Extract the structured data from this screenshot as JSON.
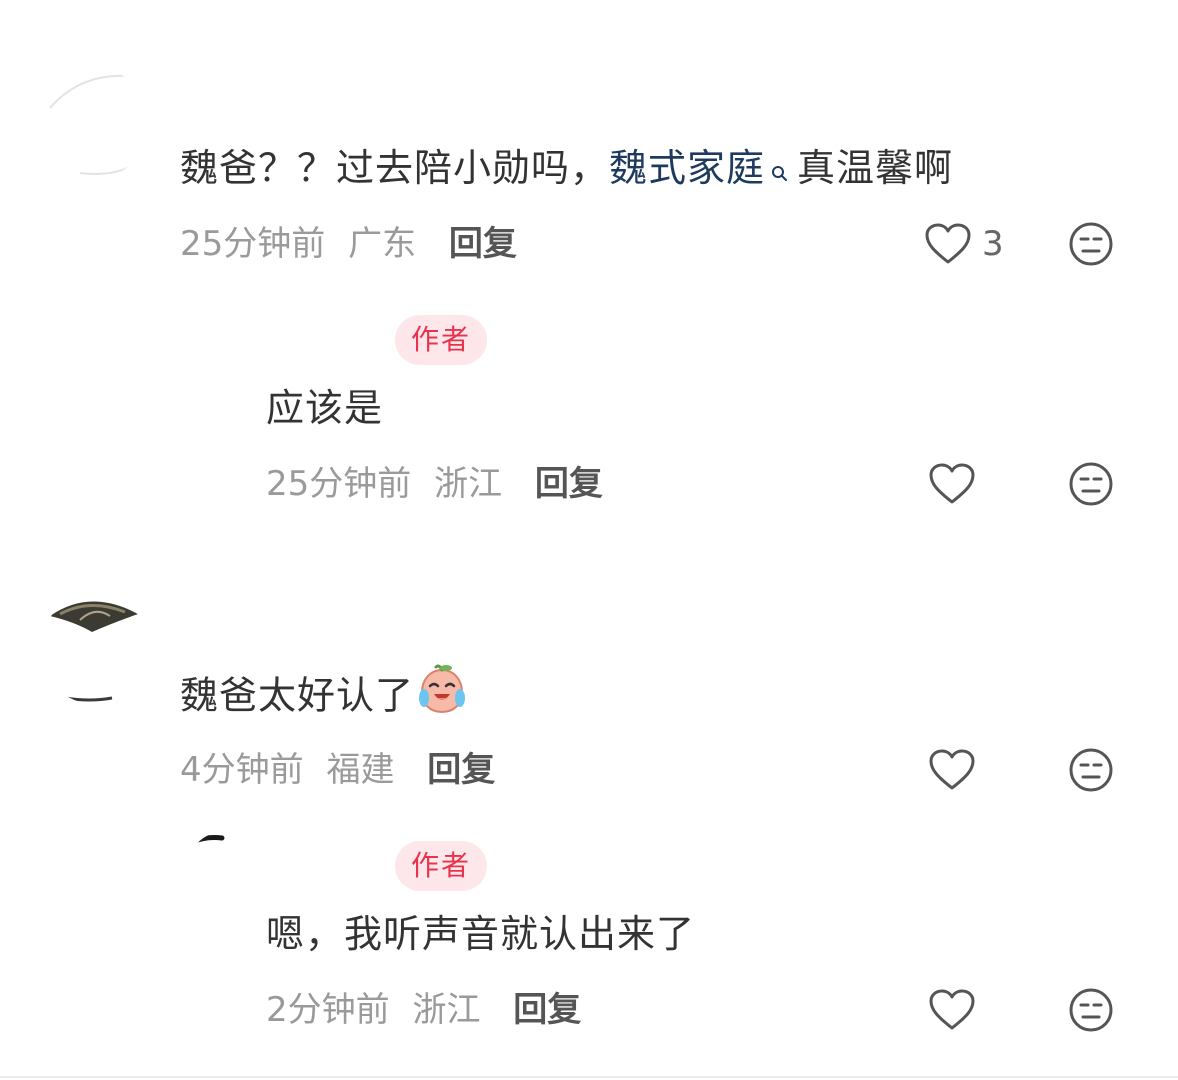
{
  "comments": [
    {
      "text_before": "魏爸？？过去陪小勋吗，",
      "topic": "魏式家庭",
      "text_after": "真温馨啊",
      "time": "25分钟前",
      "location": "广东",
      "reply_label": "回复",
      "like_count": "3",
      "reply": {
        "badge": "作者",
        "text": "应该是",
        "time": "25分钟前",
        "location": "浙江",
        "reply_label": "回复"
      }
    },
    {
      "text": "魏爸太好认了",
      "emoji": "crying-laughing-peach-emoji",
      "time": "4分钟前",
      "location": "福建",
      "reply_label": "回复",
      "reply": {
        "badge": "作者",
        "text": "嗯，我听声音就认出来了",
        "time": "2分钟前",
        "location": "浙江",
        "reply_label": "回复"
      }
    }
  ],
  "icons": {
    "like": "heart-outline-icon",
    "dislike": "neutral-face-icon",
    "topic_search": "search-icon"
  },
  "colors": {
    "topic_link": "#1f3a5f",
    "author_badge_bg": "#fde7ea",
    "author_badge_text": "#e8334d",
    "meta_text": "#9a9a9a"
  }
}
